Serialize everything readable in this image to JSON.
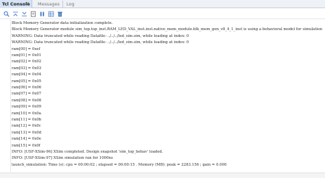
{
  "tabs": [
    {
      "label": "Tcl Console",
      "active": true,
      "close": "×"
    },
    {
      "label": "Messages",
      "active": false
    },
    {
      "label": "Log",
      "active": false
    }
  ],
  "toolbar": {
    "icons": [
      "search-icon",
      "collapse-all-icon",
      "expand-all-icon",
      "clear-icon",
      "pause-icon",
      "grid-icon",
      "delete-icon"
    ]
  },
  "console": {
    "lines": [
      " Block Memory Generator data initialization complete.",
      "Block Memory Generator module sim_top.top_inst.RAM_LED_VAL_inst.inst.native_mem_module.blk_mem_gen_v8_4_1_inst is using a behavioral model for simulation",
      "WARNING: Data truncated while reading Datafile: ../../../led_sim.sim, while loading at index: 0",
      "WARNING: Data truncated while reading Datafile: ../../../led_sim.sim, while loading at index: 0",
      "ram[00] = 0xef",
      "ram[01] = 0x01",
      "ram[02] = 0x02",
      "ram[03] = 0x03",
      "ram[04] = 0x04",
      "ram[05] = 0x05",
      "ram[06] = 0x06",
      "ram[07] = 0x07",
      "ram[08] = 0x08",
      "ram[09] = 0x09",
      "ram[10] = 0x0a",
      "ram[11] = 0x0b",
      "ram[12] = 0x0c",
      "ram[13] = 0x0d",
      "ram[14] = 0x0e",
      "ram[15] = 0x0f",
      "INFO: [USF-XSim-96] XSim completed. Design snapshot 'sim_top_behav' loaded.",
      "INFO: [USF-XSim-97] XSim simulation ran for 1000ns",
      "launch_simulation: Time (s): cpu = 00:00:02 ; elapsed = 00:00:15 . Memory (MB): peak = 2283.156 ; gain = 0.000"
    ]
  }
}
